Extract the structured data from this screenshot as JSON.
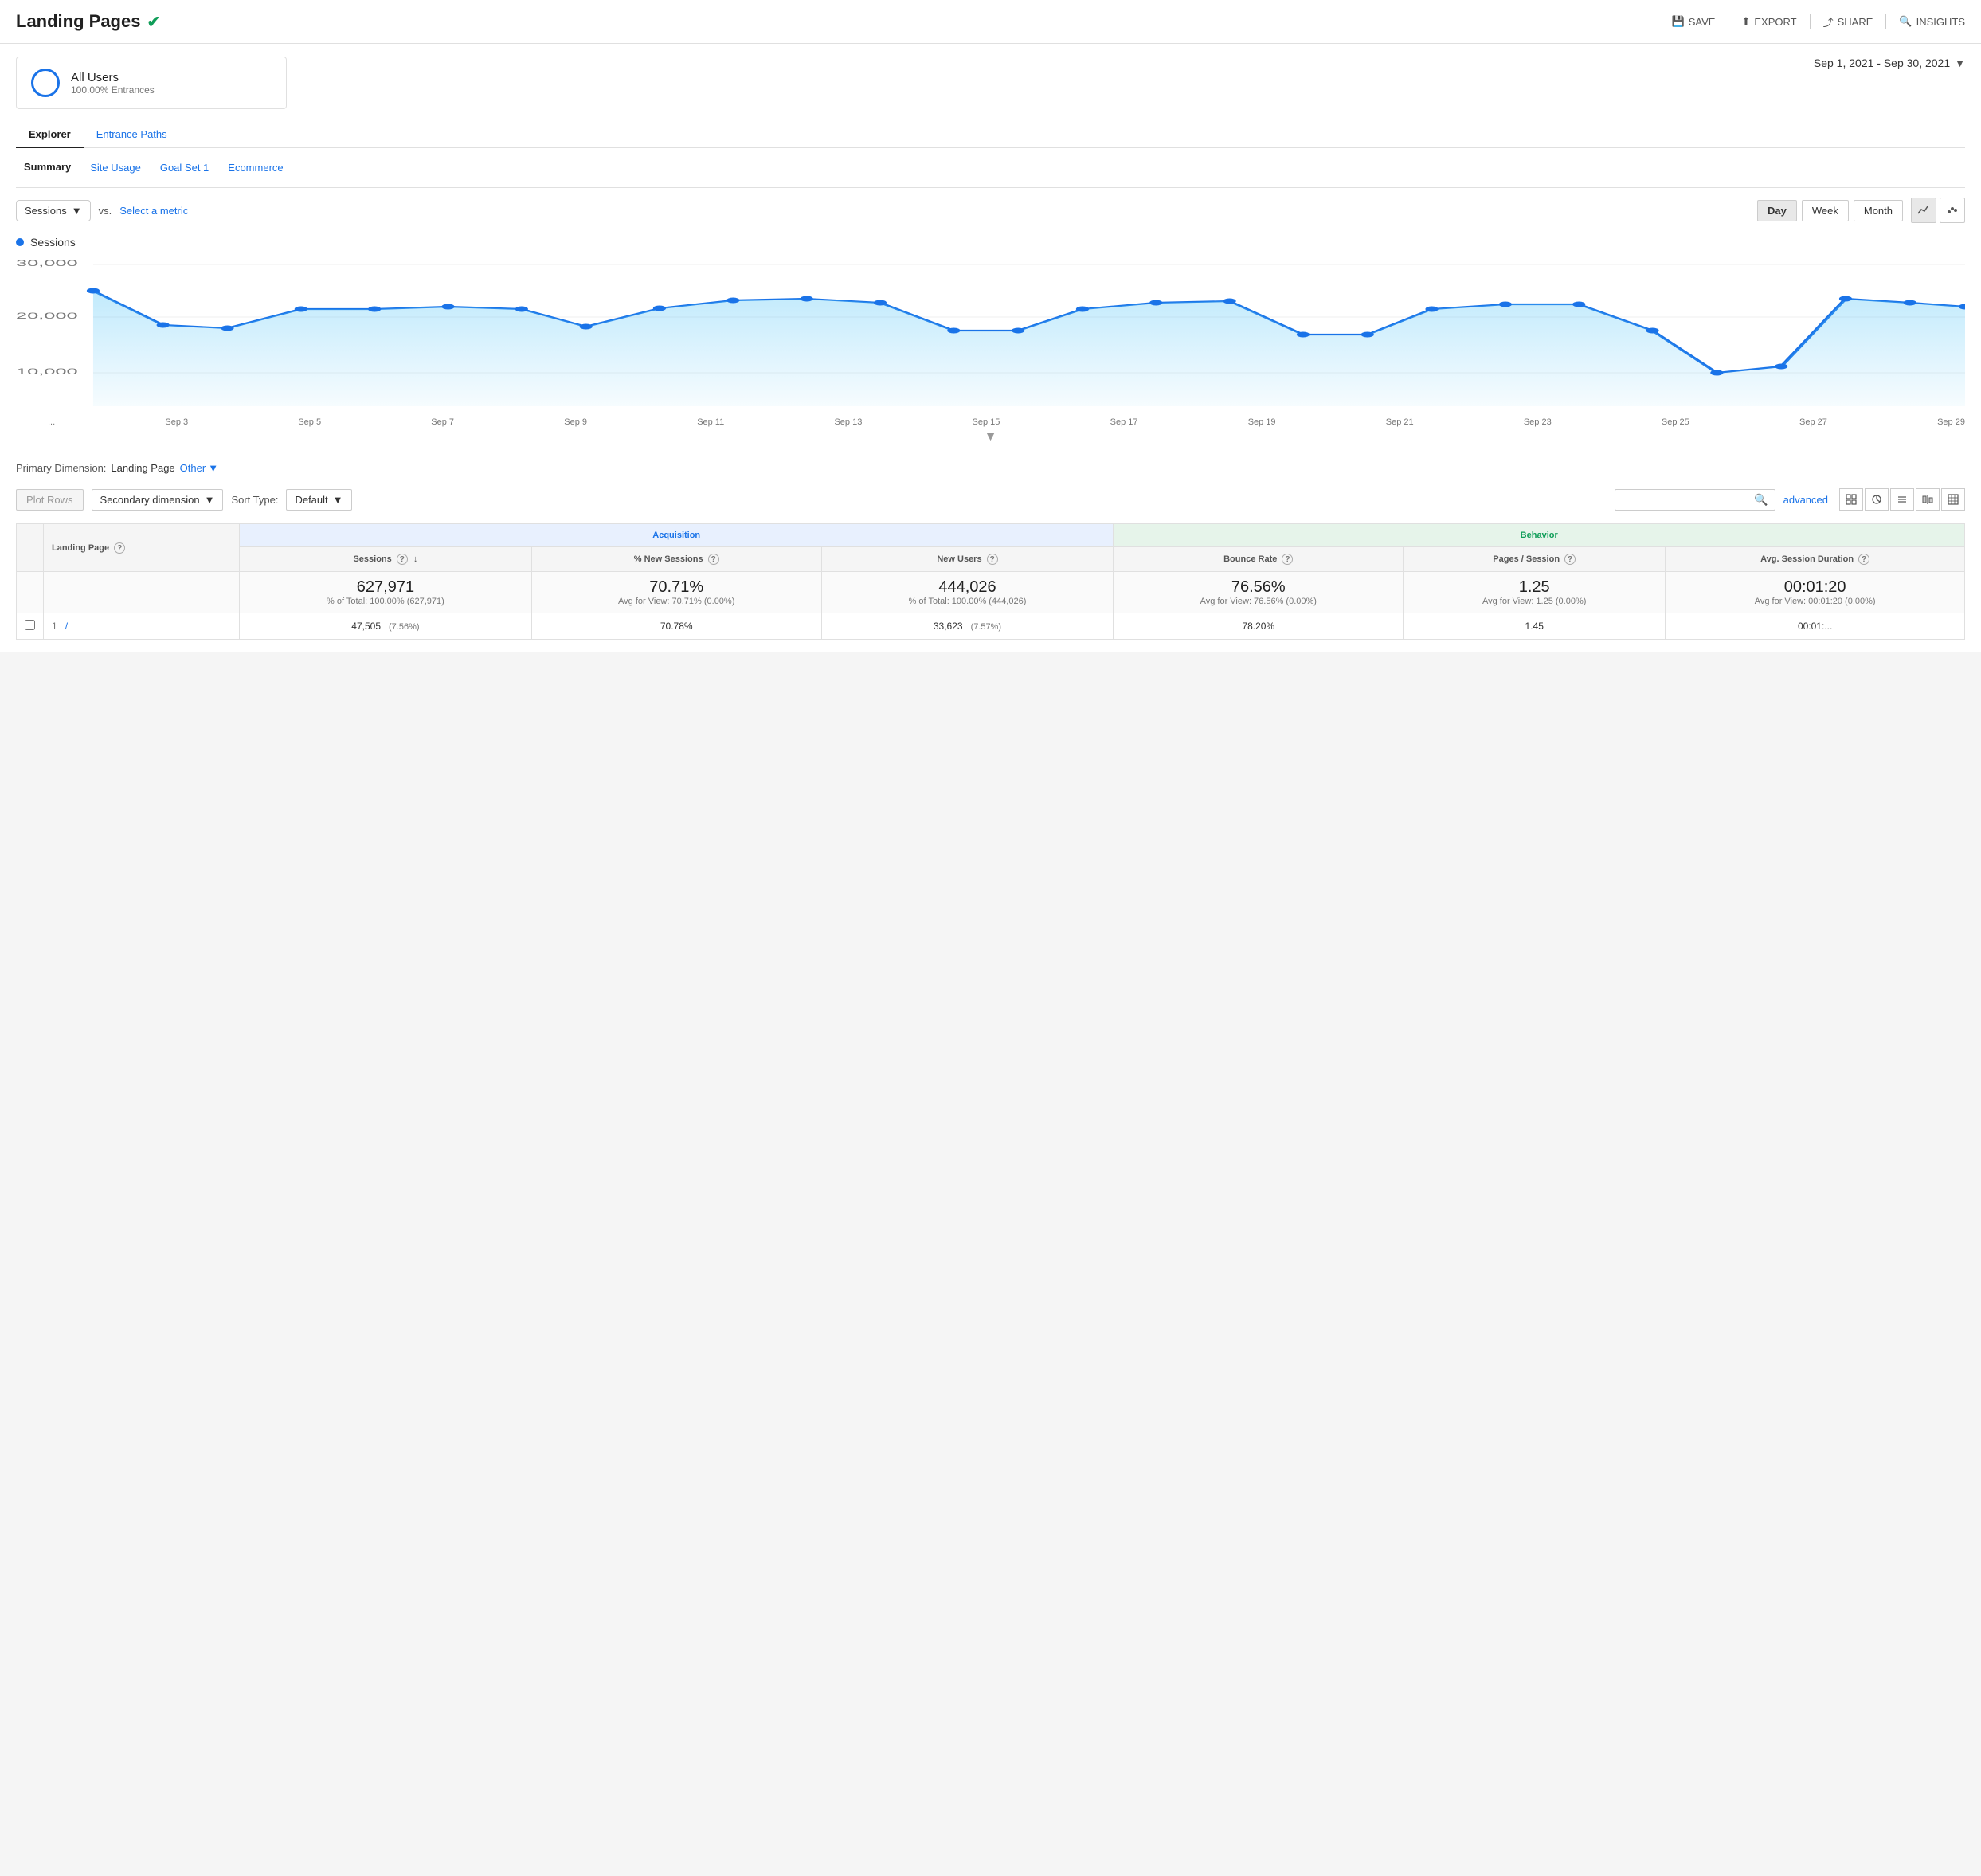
{
  "header": {
    "title": "Landing Pages",
    "save_label": "SAVE",
    "export_label": "EXPORT",
    "share_label": "SHARE",
    "insights_label": "INSIGHTS"
  },
  "segment": {
    "name": "All Users",
    "sub": "100.00% Entrances"
  },
  "date_range": "Sep 1, 2021 - Sep 30, 2021",
  "tabs": [
    {
      "label": "Explorer",
      "active": true
    },
    {
      "label": "Entrance Paths",
      "active": false
    }
  ],
  "subtabs": [
    {
      "label": "Summary",
      "active": true
    },
    {
      "label": "Site Usage",
      "active": false
    },
    {
      "label": "Goal Set 1",
      "active": false
    },
    {
      "label": "Ecommerce",
      "active": false
    }
  ],
  "chart": {
    "metric_label": "Sessions",
    "vs_label": "vs.",
    "select_metric_label": "Select a metric",
    "legend_label": "Sessions",
    "time_buttons": [
      "Day",
      "Week",
      "Month"
    ],
    "active_time": "Day",
    "y_labels": [
      "30,000",
      "20,000",
      "10,000"
    ],
    "x_labels": [
      "...",
      "Sep 3",
      "Sep 5",
      "Sep 7",
      "Sep 9",
      "Sep 11",
      "Sep 13",
      "Sep 15",
      "Sep 17",
      "Sep 19",
      "Sep 21",
      "Sep 23",
      "Sep 25",
      "Sep 27",
      "Sep 29"
    ]
  },
  "primary_dim": {
    "label": "Primary Dimension:",
    "page_label": "Landing Page",
    "other_label": "Other"
  },
  "table_controls": {
    "plot_rows_label": "Plot Rows",
    "secondary_dim_label": "Secondary dimension",
    "sort_type_label": "Sort Type:",
    "default_label": "Default",
    "search_placeholder": "",
    "advanced_label": "advanced"
  },
  "table": {
    "col_groups": [
      {
        "label": "",
        "colspan": 1
      },
      {
        "label": "Acquisition",
        "colspan": 3
      },
      {
        "label": "Behavior",
        "colspan": 4
      }
    ],
    "headers": [
      "Landing Page",
      "Sessions",
      "% New Sessions",
      "New Users",
      "Bounce Rate",
      "Pages / Session",
      "Avg. Session Duration"
    ],
    "totals": {
      "sessions": "627,971",
      "sessions_pct": "% of Total: 100.00% (627,971)",
      "new_sessions_pct": "70.71%",
      "new_sessions_avg": "Avg for View: 70.71% (0.00%)",
      "new_users": "444,026",
      "new_users_pct": "% of Total: 100.00% (444,026)",
      "bounce_rate": "76.56%",
      "bounce_rate_avg": "Avg for View: 76.56% (0.00%)",
      "pages_session": "1.25",
      "pages_session_avg": "Avg for View: 1.25 (0.00%)",
      "avg_duration": "00:01:20",
      "avg_duration_avg": "Avg for View: 00:01:20 (0.00%)"
    },
    "rows": [
      {
        "num": "1",
        "page": "/",
        "sessions": "47,505",
        "sessions_pct": "(7.56%)",
        "new_sessions": "70.78%",
        "new_users": "33,623",
        "new_users_pct": "(7.57%)",
        "bounce_rate": "78.20%",
        "pages_session": "1.45",
        "avg_duration": "00:01:..."
      }
    ]
  }
}
